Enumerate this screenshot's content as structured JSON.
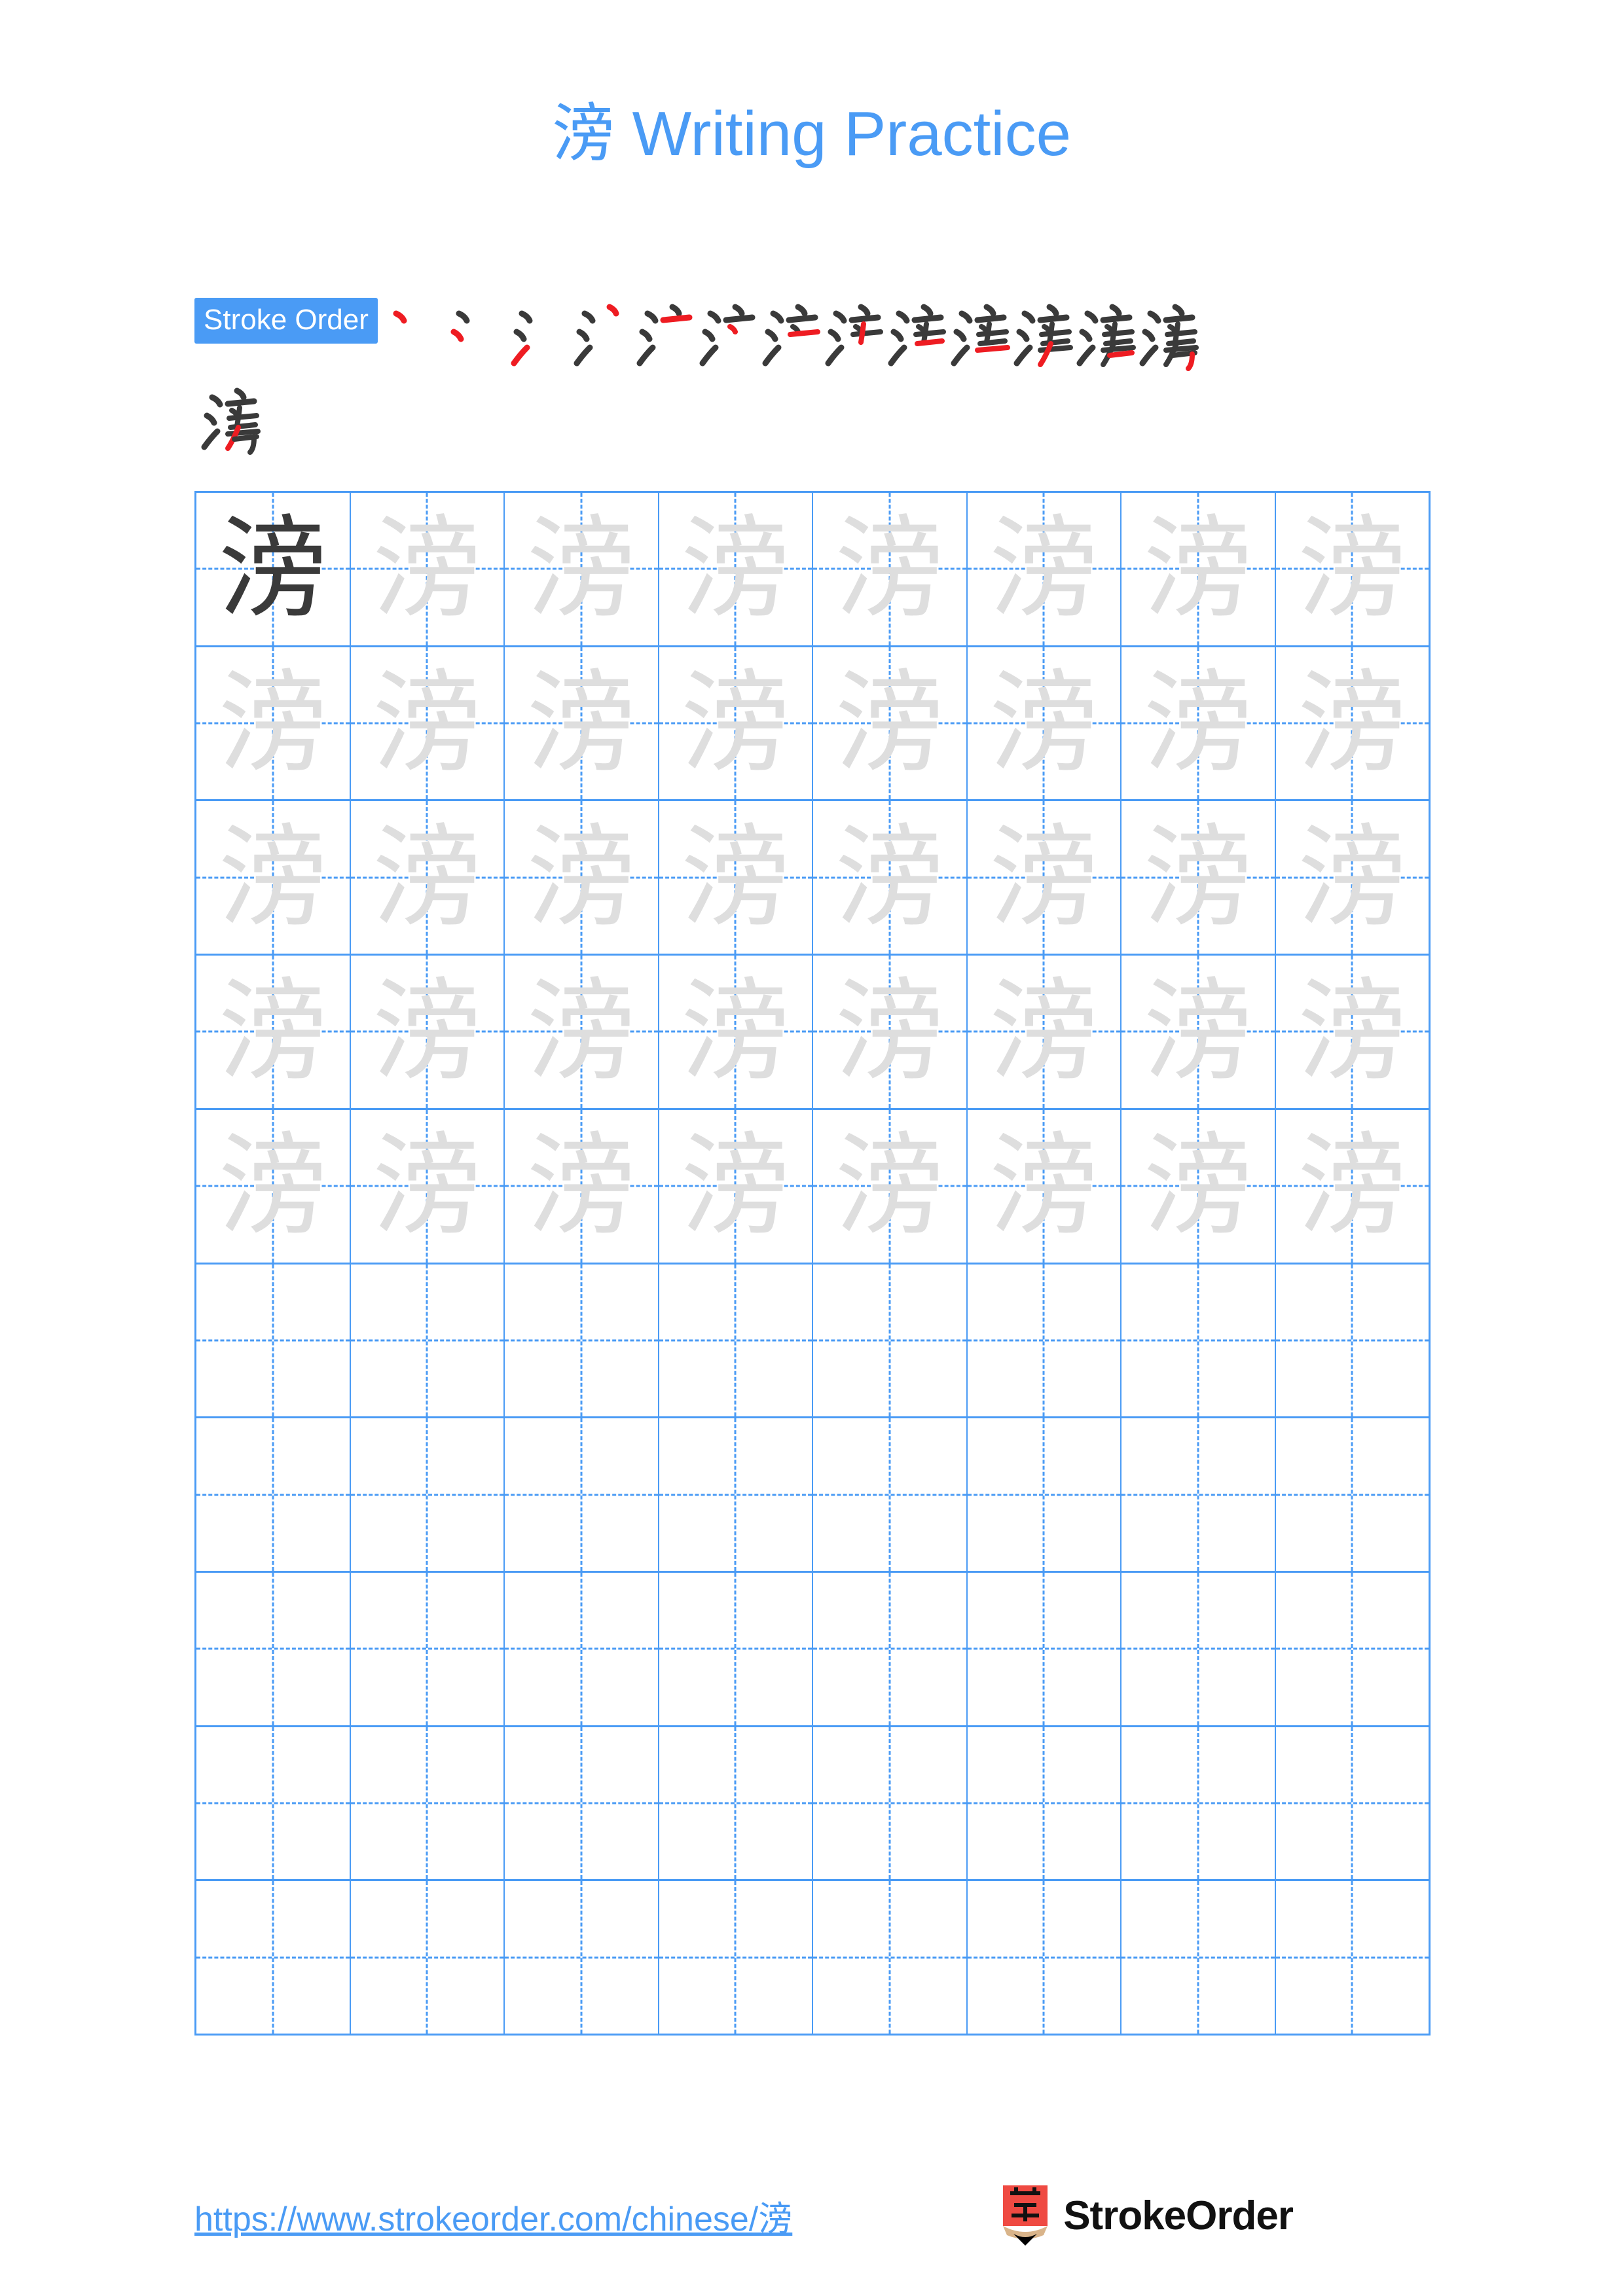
{
  "page": {
    "character": "滂",
    "title": "滂 Writing Practice",
    "title_suffix": " Writing Practice",
    "background_color": "#ffffff",
    "accent_color": "#4a9bf5",
    "new_stroke_color": "#ee1c22",
    "existing_stroke_color": "#3a3a3a",
    "trace_color": "#dedede"
  },
  "stroke_order": {
    "badge_label": "Stroke Order",
    "total_strokes": 13,
    "steps": [
      {
        "index": 1,
        "strokes_shown": 1,
        "new_stroke_name": "dian"
      },
      {
        "index": 2,
        "strokes_shown": 2,
        "new_stroke_name": "dian"
      },
      {
        "index": 3,
        "strokes_shown": 3,
        "new_stroke_name": "ti"
      },
      {
        "index": 4,
        "strokes_shown": 4,
        "new_stroke_name": "dian"
      },
      {
        "index": 5,
        "strokes_shown": 5,
        "new_stroke_name": "heng"
      },
      {
        "index": 6,
        "strokes_shown": 6,
        "new_stroke_name": "dian"
      },
      {
        "index": 7,
        "strokes_shown": 7,
        "new_stroke_name": "heng"
      },
      {
        "index": 8,
        "strokes_shown": 8,
        "new_stroke_name": "shu"
      },
      {
        "index": 9,
        "strokes_shown": 9,
        "new_stroke_name": "heng"
      },
      {
        "index": 10,
        "strokes_shown": 10,
        "new_stroke_name": "heng"
      },
      {
        "index": 11,
        "strokes_shown": 11,
        "new_stroke_name": "pie"
      },
      {
        "index": 12,
        "strokes_shown": 12,
        "new_stroke_name": "heng"
      },
      {
        "index": 13,
        "strokes_shown": 13,
        "new_stroke_name": "henggou"
      }
    ]
  },
  "practice_grid": {
    "columns": 8,
    "rows": 10,
    "filled_rows": 5,
    "empty_rows": 5,
    "cell_states": [
      [
        "solid",
        "trace",
        "trace",
        "trace",
        "trace",
        "trace",
        "trace",
        "trace"
      ],
      [
        "trace",
        "trace",
        "trace",
        "trace",
        "trace",
        "trace",
        "trace",
        "trace"
      ],
      [
        "trace",
        "trace",
        "trace",
        "trace",
        "trace",
        "trace",
        "trace",
        "trace"
      ],
      [
        "trace",
        "trace",
        "trace",
        "trace",
        "trace",
        "trace",
        "trace",
        "trace"
      ],
      [
        "trace",
        "trace",
        "trace",
        "trace",
        "trace",
        "trace",
        "trace",
        "trace"
      ],
      [
        "empty",
        "empty",
        "empty",
        "empty",
        "empty",
        "empty",
        "empty",
        "empty"
      ],
      [
        "empty",
        "empty",
        "empty",
        "empty",
        "empty",
        "empty",
        "empty",
        "empty"
      ],
      [
        "empty",
        "empty",
        "empty",
        "empty",
        "empty",
        "empty",
        "empty",
        "empty"
      ],
      [
        "empty",
        "empty",
        "empty",
        "empty",
        "empty",
        "empty",
        "empty",
        "empty"
      ],
      [
        "empty",
        "empty",
        "empty",
        "empty",
        "empty",
        "empty",
        "empty",
        "empty"
      ]
    ]
  },
  "footer": {
    "url": "https://www.strokeorder.com/chinese/滂",
    "brand_name": "StrokeOrder",
    "logo_character": "字",
    "logo_body_color": "#ef4a42",
    "logo_wood_color": "#d9b48a",
    "logo_tip_color": "#000000"
  }
}
